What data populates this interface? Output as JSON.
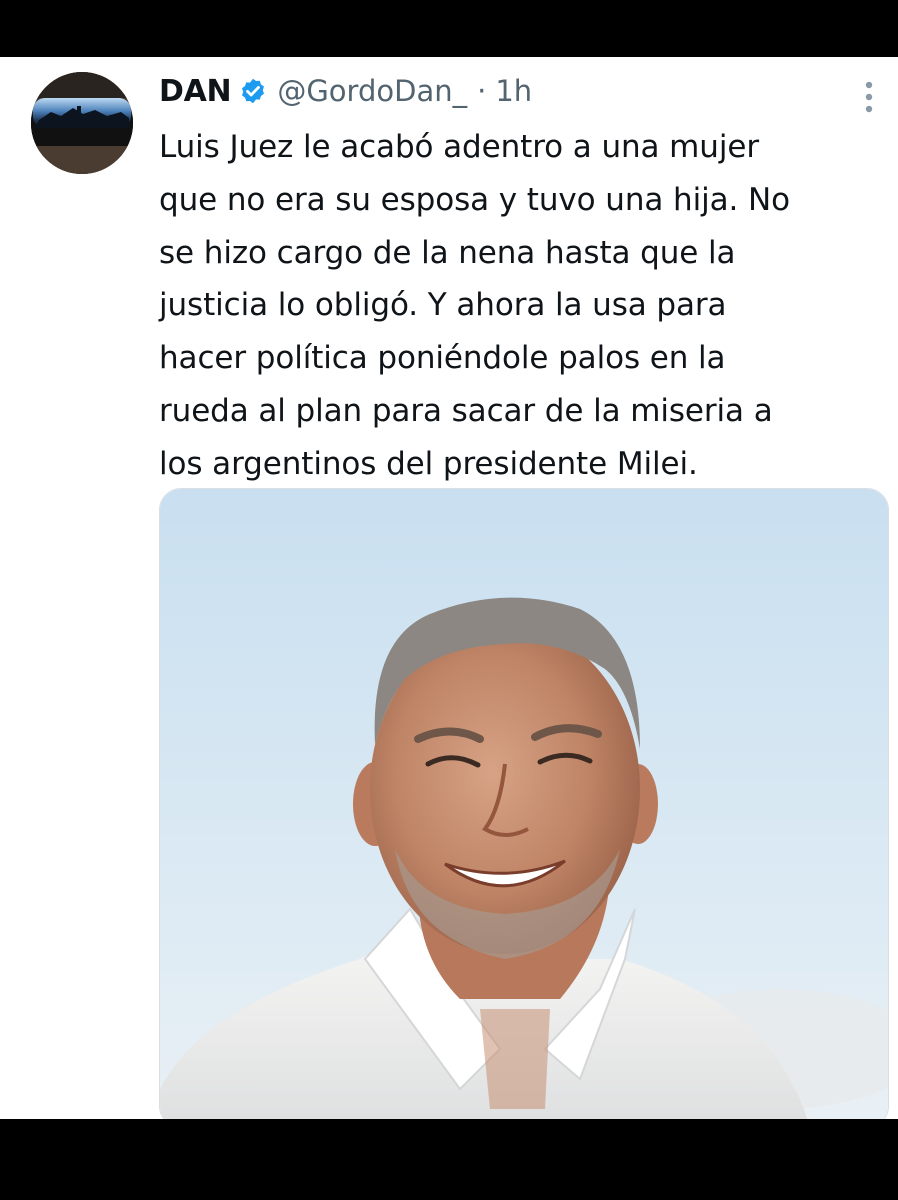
{
  "tweet": {
    "author": {
      "display_name": "DAN",
      "handle": "@GordoDan_",
      "verified_icon": "verified-badge-icon",
      "avatar_icon": "avatar-sunglasses-reflection"
    },
    "separator": "·",
    "time": "1h",
    "more_icon": "more-vertical-icon",
    "text_lines": [
      "Luis Juez le acabó adentro a una mujer",
      "que no era su esposa y tuvo una hija. No",
      "se hizo cargo de la nena hasta que la",
      "justicia lo obligó. Y ahora la usa para",
      "hacer política poniéndole palos en la",
      "rueda al plan para sacar de la miseria a",
      "los argentinos del presidente Milei."
    ],
    "media": {
      "kind": "photo",
      "subject": "smiling-man-white-shirt-photo"
    }
  },
  "colors": {
    "background": "#ffffff",
    "frame": "#000000",
    "text_primary": "#0f1419",
    "text_secondary": "#536471",
    "verified_blue": "#1d9bf0"
  }
}
